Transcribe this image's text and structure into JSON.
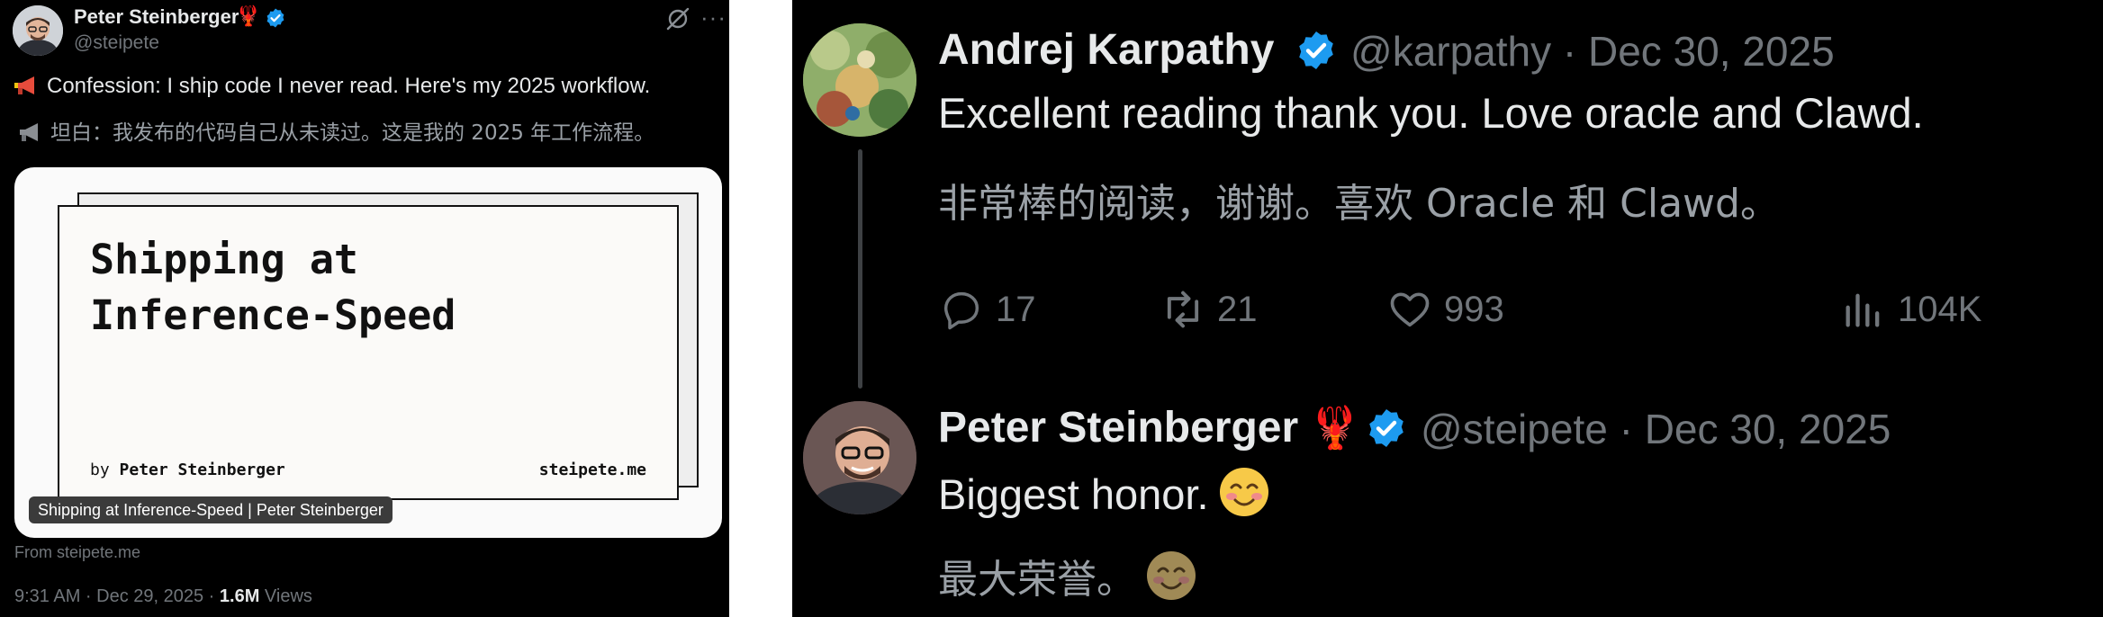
{
  "left_post": {
    "author_name": "Peter Steinberger",
    "author_emoji": "🦞",
    "handle": "@steipete",
    "text_en": "Confession: I ship code I never read. Here's my 2025 workflow.",
    "text_zh": "坦白：我发布的代码自己从未读过。这是我的 2025 年工作流程。",
    "card": {
      "title": "Shipping at\nInference-Speed",
      "by_prefix": "by",
      "by_author": "Peter Steinberger",
      "site": "steipete.me",
      "caption": "Shipping at Inference-Speed | Peter Steinberger"
    },
    "from": "From steipete.me",
    "timestamp": "9:31 AM · Dec 29, 2025 · ",
    "views_count": "1.6M",
    "views_label": " Views"
  },
  "right_thread": {
    "reply1": {
      "author_name": "Andrej Karpathy",
      "handle_date": "@karpathy · Dec 30, 2025",
      "text_en": "Excellent reading thank you. Love oracle and Clawd.",
      "text_zh": "非常棒的阅读，谢谢。喜欢 Oracle 和 Clawd。",
      "replies": "17",
      "reposts": "21",
      "likes": "993",
      "views": "104K"
    },
    "reply2": {
      "author_name": "Peter Steinberger",
      "author_emoji": "🦞",
      "handle_date": "@steipete · Dec 30, 2025",
      "text_en": "Biggest honor.",
      "text_zh": "最大荣誉。"
    }
  },
  "colors": {
    "background": "#000000",
    "text": "#e7e9ea",
    "muted": "#71767b",
    "verified": "#1d9bf0"
  }
}
